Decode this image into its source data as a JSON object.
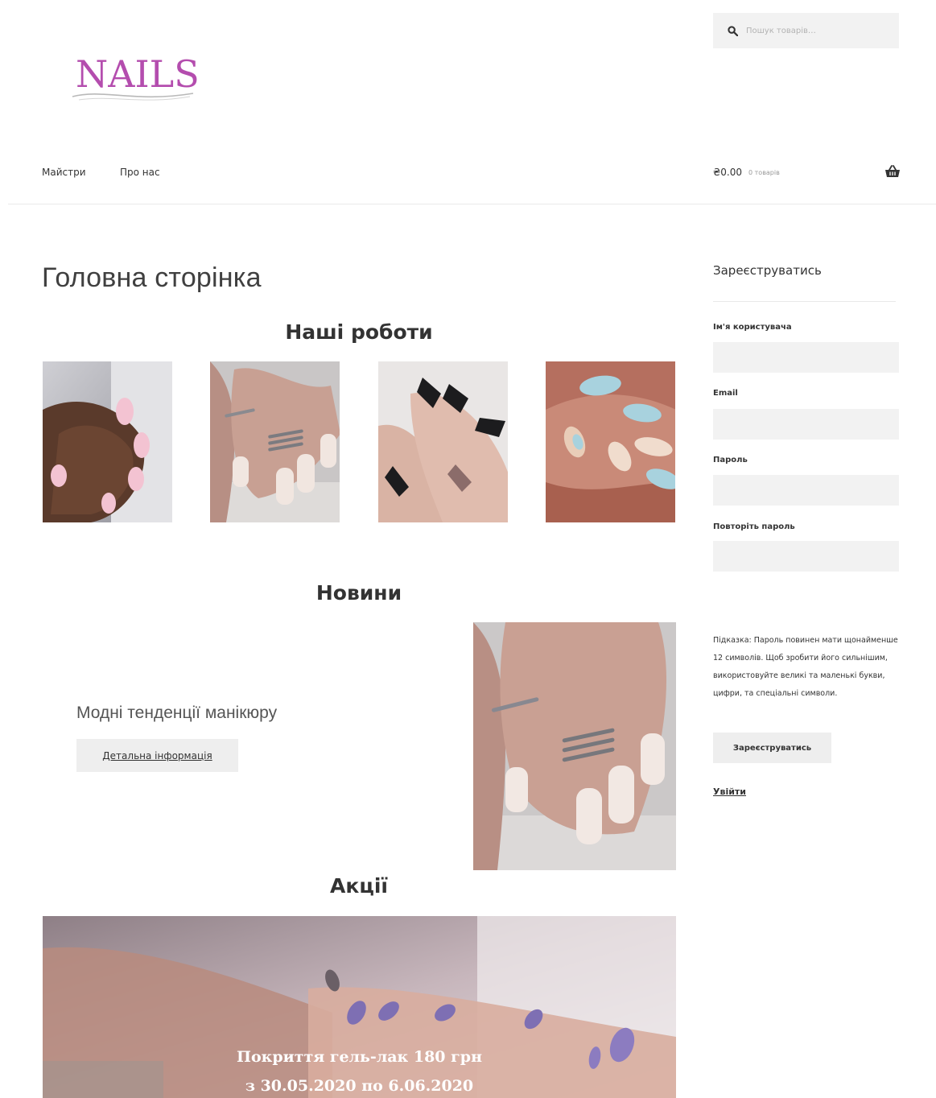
{
  "brand": {
    "logo_text": "NAILS"
  },
  "search": {
    "placeholder": "Пошук товарів…"
  },
  "nav": {
    "items": [
      {
        "label": "Майстри"
      },
      {
        "label": "Про нас"
      }
    ]
  },
  "cart": {
    "amount": "₴0.00",
    "count": "0 товарів"
  },
  "main": {
    "page_title": "Головна сторінка",
    "works_title": "Наші роботи",
    "news_title": "Новини",
    "news_item": {
      "title": "Модні тенденції манікюру",
      "button": "Детальна інформація"
    },
    "promo_title": "Акції",
    "promo": {
      "line1": "Покриття гель-лак 180 грн",
      "line2": "з 30.05.2020 по 6.06.2020"
    }
  },
  "sidebar": {
    "title": "Зареєструватись",
    "fields": [
      {
        "label": "Ім'я користувача"
      },
      {
        "label": "Email"
      },
      {
        "label": "Пароль"
      },
      {
        "label": "Повторіть пароль"
      }
    ],
    "hint": "Підказка: Пароль повинен мати щонайменше 12 символів. Щоб зробити його сильнішим, використовуйте великі та маленькі букви, цифри, та спеціальні символи.",
    "register_button": "Зареєструватись",
    "login_link": "Увійти"
  },
  "colors": {
    "logo": "#b44dae",
    "field_bg": "#f2f2f2",
    "button_bg": "#eeeeee"
  }
}
